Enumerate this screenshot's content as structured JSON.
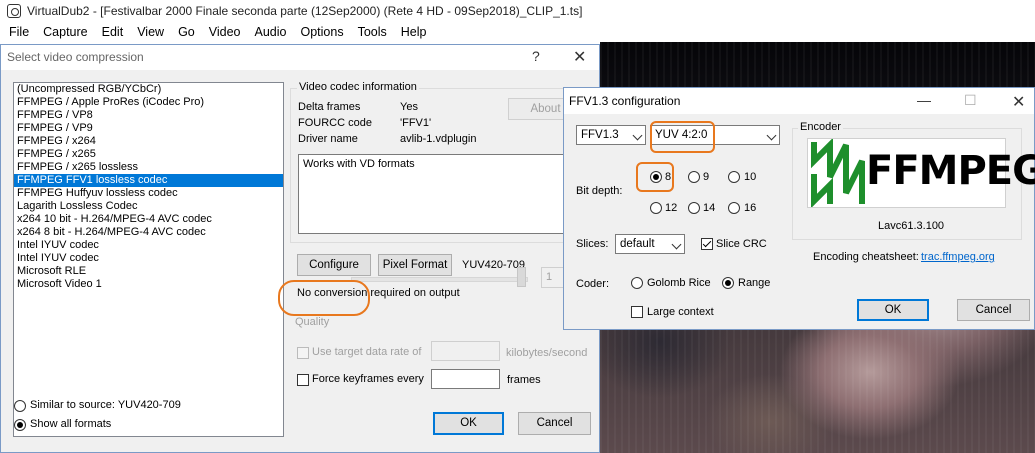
{
  "main": {
    "title": "VirtualDub2 - [Festivalbar 2000 Finale seconda parte (12Sep2000) (Rete 4 HD - 09Sep2018)_CLIP_1.ts]",
    "menu": [
      "File",
      "Capture",
      "Edit",
      "View",
      "Go",
      "Video",
      "Audio",
      "Options",
      "Tools",
      "Help"
    ]
  },
  "compression": {
    "title": "Select video compression",
    "help_glyph": "?",
    "close_glyph": "✕",
    "codecs": [
      "(Uncompressed RGB/YCbCr)",
      "FFMPEG / Apple ProRes (iCodec Pro)",
      "FFMPEG / VP8",
      "FFMPEG / VP9",
      "FFMPEG / x264",
      "FFMPEG / x265",
      "FFMPEG / x265 lossless",
      "FFMPEG FFV1 lossless codec",
      "FFMPEG Huffyuv lossless codec",
      "Lagarith Lossless Codec",
      "x264 10 bit - H.264/MPEG-4 AVC codec",
      "x264 8 bit - H.264/MPEG-4 AVC codec",
      "Intel IYUV codec",
      "Intel IYUV codec",
      "Microsoft RLE",
      "Microsoft Video 1"
    ],
    "selected_index": 7,
    "info_group": "Video codec information",
    "delta_frames_label": "Delta frames",
    "delta_frames_value": "Yes",
    "fourcc_label": "FOURCC code",
    "fourcc_value": "'FFV1'",
    "driver_label": "Driver name",
    "driver_value": "avlib-1.vdplugin",
    "about_label": "About",
    "description": "Works with VD formats",
    "configure_label": "Configure",
    "pixel_format_label": "Pixel Format",
    "pixel_format_value": "YUV420-709",
    "conversion_note": "No conversion required on output",
    "quality_label": "Quality",
    "quality_value": "1",
    "target_rate_label": "Use target data rate of",
    "target_rate_unit": "kilobytes/second",
    "keyframes_label": "Force keyframes every",
    "keyframes_unit": "frames",
    "similar_label": "Similar to source: YUV420-709",
    "show_all_label": "Show all formats",
    "ok_label": "OK",
    "cancel_label": "Cancel"
  },
  "ffv1": {
    "title": "FFV1.3 configuration",
    "minimize_glyph": "—",
    "maximize_glyph": "☐",
    "close_glyph": "✕",
    "version": "FFV1.3",
    "colorspace": "YUV 4:2:0",
    "bit_depth_label": "Bit depth:",
    "bit_depths": [
      "8",
      "9",
      "10",
      "12",
      "14",
      "16"
    ],
    "bit_depth_selected": "8",
    "slices_label": "Slices:",
    "slices_value": "default",
    "slice_crc_label": "Slice CRC",
    "coder_label": "Coder:",
    "coder_golomb": "Golomb Rice",
    "coder_range": "Range",
    "large_context_label": "Large context",
    "encoder_group": "Encoder",
    "logo_text": "FFMPEG",
    "encoder_version": "Lavc61.3.100",
    "cheatsheet_label": "Encoding cheatsheet:",
    "cheatsheet_link": "trac.ffmpeg.org",
    "ok_label": "OK",
    "cancel_label": "Cancel"
  },
  "colors": {
    "selection": "#0078d7",
    "annotation": "#e8781e",
    "ffmpeg_green": "#1e8f2c",
    "link": "#0066cc"
  }
}
